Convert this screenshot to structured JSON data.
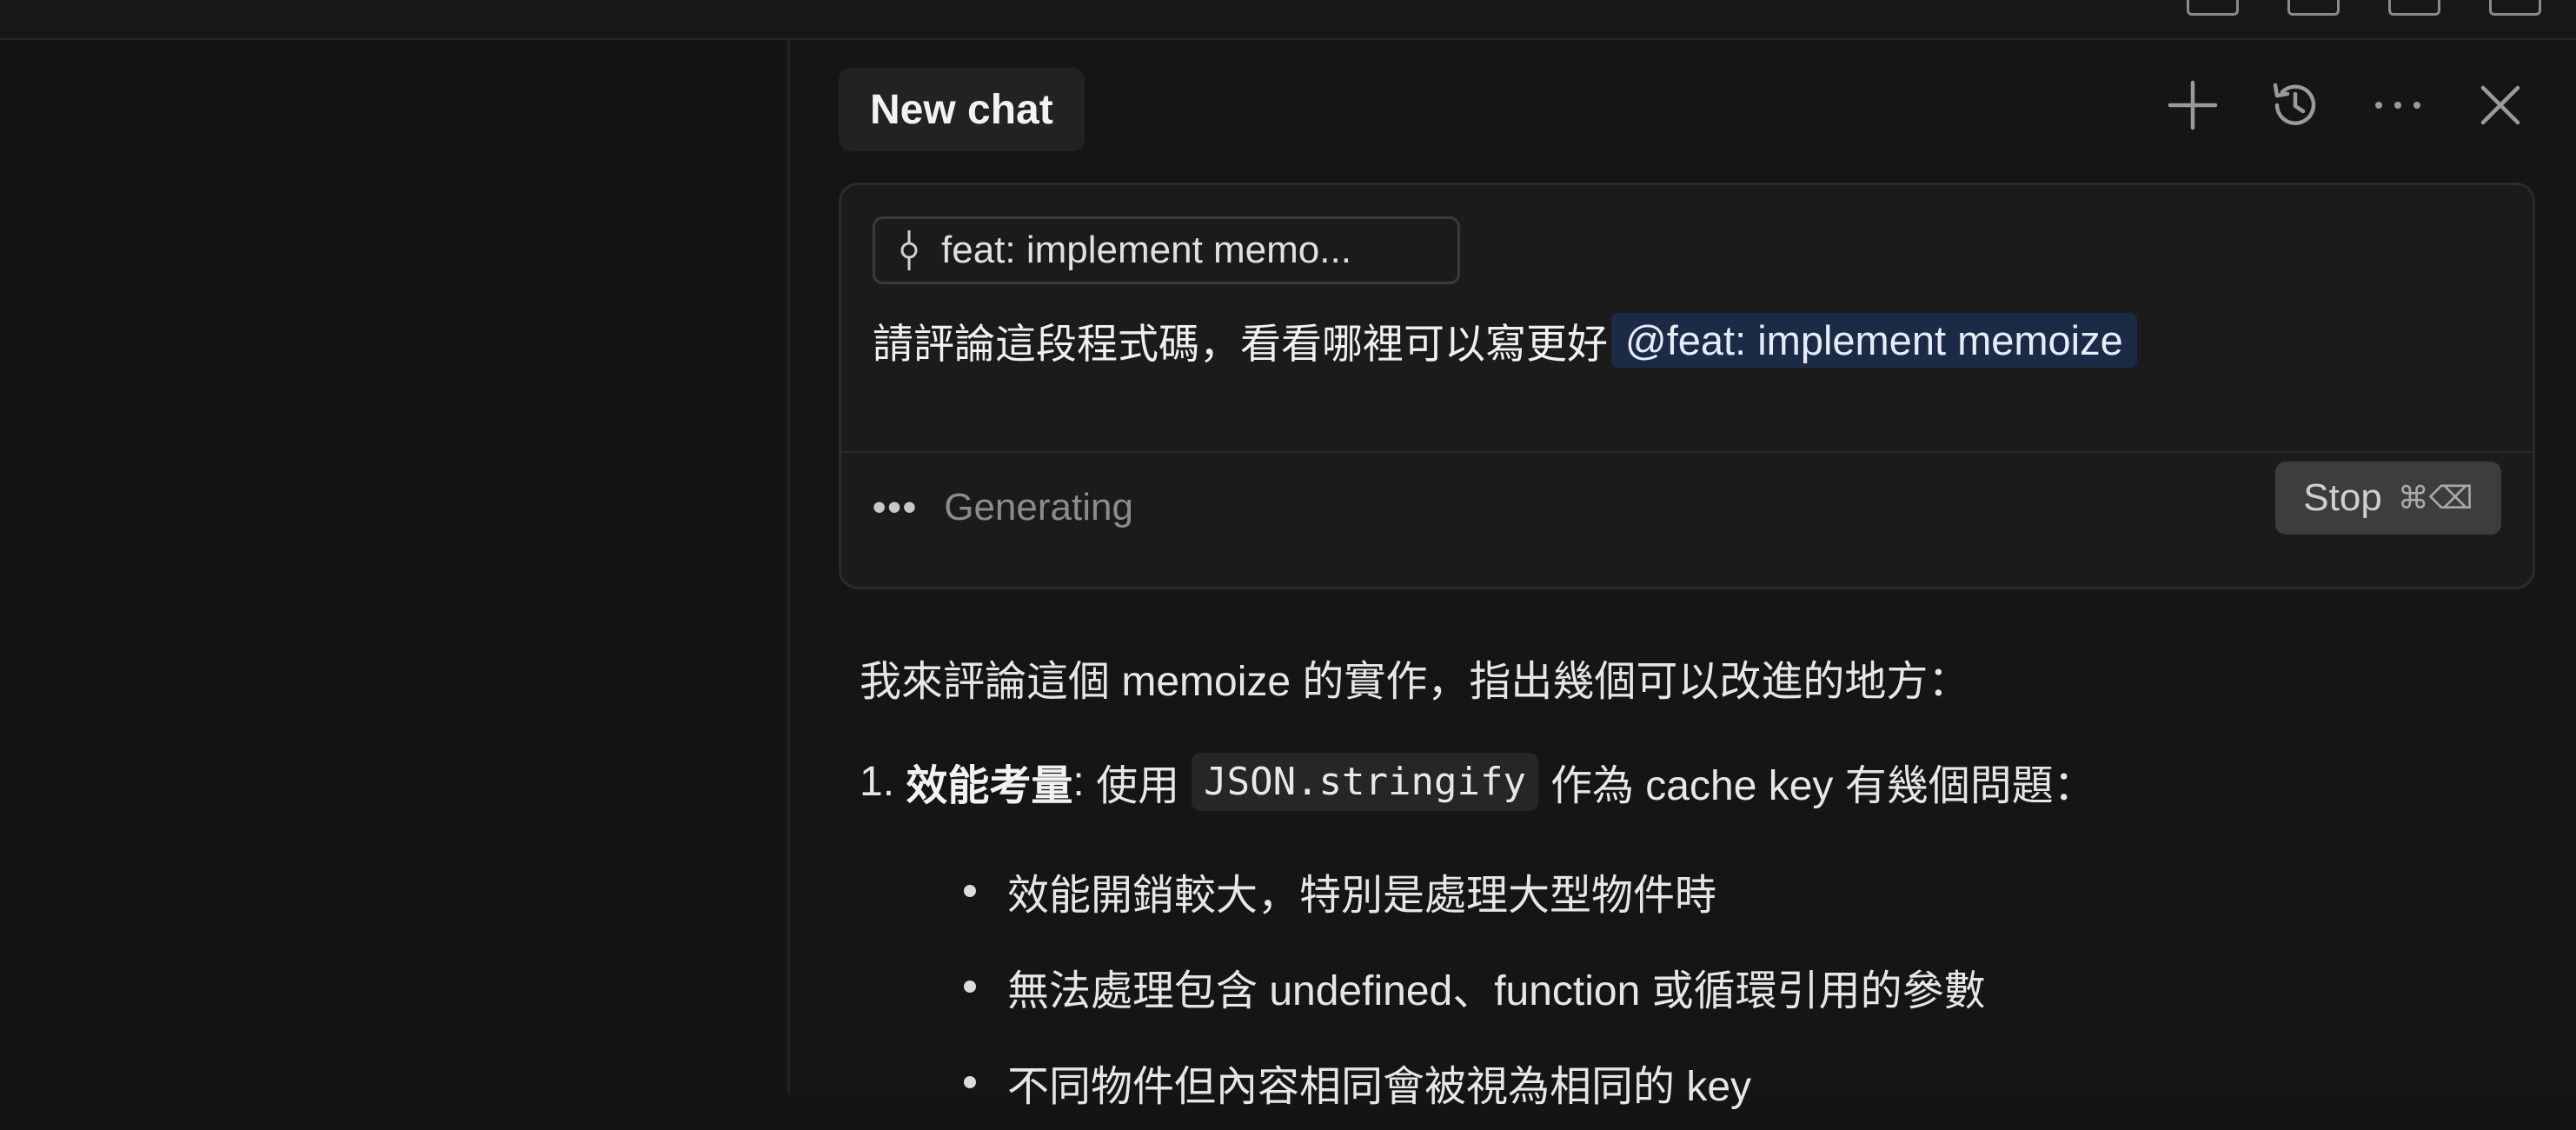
{
  "header": {
    "tab_label": "New chat",
    "icons": [
      "plus-icon",
      "history-icon",
      "more-icon",
      "close-icon"
    ]
  },
  "composer": {
    "context_chip_label": "feat: implement memo...",
    "prompt_text": "請評論這段程式碼，看看哪裡可以寫更好",
    "mention_text": "@feat: implement memoize",
    "status_text": "Generating",
    "stop_label": "Stop",
    "stop_shortcut": "⌘⌫"
  },
  "response": {
    "intro": "我來評論這個 memoize 的實作，指出幾個可以改進的地方：",
    "item_number": "1.",
    "item_title": "效能考量",
    "item_colon": ":",
    "item_pre": "使用",
    "item_code": "JSON.stringify",
    "item_post": "作為 cache key 有幾個問題：",
    "bullets": [
      "效能開銷較大，特別是處理大型物件時",
      "無法處理包含 undefined、function 或循環引用的參數",
      "不同物件但內容相同會被視為相同的 key"
    ]
  },
  "colors": {
    "background": "#141414",
    "panel": "#151515",
    "composer": "#1b1b1b",
    "mention_bg": "#1c2b45",
    "stop_bg": "#3d3d3d"
  }
}
